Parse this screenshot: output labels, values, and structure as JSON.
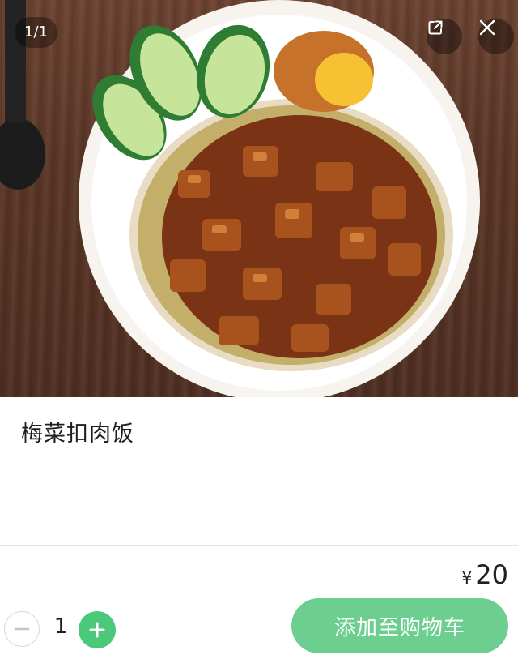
{
  "viewer": {
    "counter": "1/1",
    "share_icon": "external-link-icon",
    "close_icon": "close-icon"
  },
  "product": {
    "name": "梅菜扣肉饭",
    "currency": "¥",
    "price": "20"
  },
  "cart": {
    "quantity": "1",
    "minus_icon": "minus-icon",
    "plus_icon": "plus-icon",
    "add_label": "添加至购物车"
  },
  "colors": {
    "accent": "#4cc87a",
    "button": "#6ccf90",
    "text": "#1f1f1f"
  }
}
